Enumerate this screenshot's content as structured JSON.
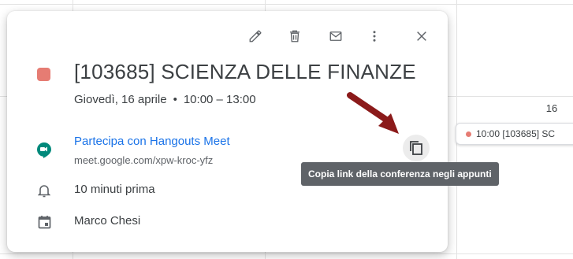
{
  "background_calendar": {
    "day_number": "16",
    "event_preview": {
      "text": "10:00 [103685] SC",
      "dot_color": "#e67c73"
    }
  },
  "popup": {
    "toolbar": {
      "icons": [
        "edit-icon",
        "delete-icon",
        "email-icon",
        "more-options-icon",
        "close-icon"
      ]
    },
    "event": {
      "color": "#e67c73",
      "title": "[103685] SCIENZA DELLE FINANZE",
      "date": "Giovedì, 16 aprile",
      "separator": "•",
      "time": "10:00 – 13:00"
    },
    "conference": {
      "icon": "hangouts-meet-icon",
      "join_label": "Partecipa con Hangouts Meet",
      "url": "meet.google.com/xpw-kroc-yfz",
      "copy_icon": "copy-icon",
      "copy_tooltip": "Copia link della conferenza negli appunti"
    },
    "notification": {
      "icon": "bell-icon",
      "text": "10 minuti prima"
    },
    "calendar": {
      "icon": "calendar-icon",
      "owner": "Marco Chesi"
    }
  },
  "annotation": {
    "arrow_color": "#8b1a1a"
  }
}
